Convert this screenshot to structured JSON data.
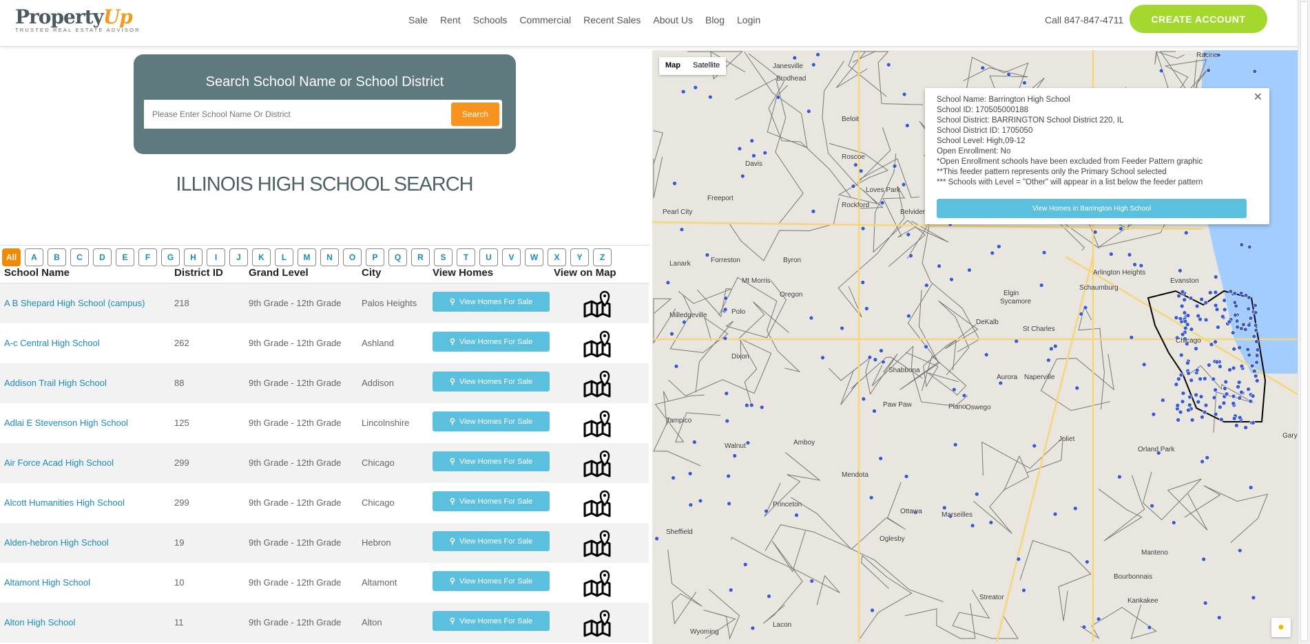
{
  "logo": {
    "text": "Property",
    "accent": "Up",
    "tagline": "TRUSTED REAL ESTATE ADVISOR"
  },
  "nav": [
    "Sale",
    "Rent",
    "Schools",
    "Commercial",
    "Recent Sales",
    "About Us",
    "Blog",
    "Login"
  ],
  "phone": "Call 847-847-4711",
  "cta": "CREATE ACCOUNT",
  "search": {
    "title": "Search School Name or School District",
    "placeholder": "Please Enter School Name Or District",
    "button": "Search"
  },
  "page_title": "ILLINOIS HIGH SCHOOL SEARCH",
  "letters": [
    "All",
    "A",
    "B",
    "C",
    "D",
    "E",
    "F",
    "G",
    "H",
    "I",
    "J",
    "K",
    "L",
    "M",
    "N",
    "O",
    "P",
    "Q",
    "R",
    "S",
    "T",
    "U",
    "V",
    "W",
    "X",
    "Y",
    "Z"
  ],
  "columns": [
    "School Name",
    "District ID",
    "Grand Level",
    "City",
    "View Homes",
    "View on Map"
  ],
  "view_button": "View Homes For Sale",
  "rows": [
    {
      "name": "A B Shepard High School (campus)",
      "district": "218",
      "level": "9th Grade - 12th Grade",
      "city": "Palos Heights"
    },
    {
      "name": "A-c Central High School",
      "district": "262",
      "level": "9th Grade - 12th Grade",
      "city": "Ashland"
    },
    {
      "name": "Addison Trail High School",
      "district": "88",
      "level": "9th Grade - 12th Grade",
      "city": "Addison"
    },
    {
      "name": "Adlai E Stevenson High School",
      "district": "125",
      "level": "9th Grade - 12th Grade",
      "city": "Lincolnshire"
    },
    {
      "name": "Air Force Acad High School",
      "district": "299",
      "level": "9th Grade - 12th Grade",
      "city": "Chicago"
    },
    {
      "name": "Alcott Humanities High School",
      "district": "299",
      "level": "9th Grade - 12th Grade",
      "city": "Chicago"
    },
    {
      "name": "Alden-hebron High School",
      "district": "19",
      "level": "9th Grade - 12th Grade",
      "city": "Hebron"
    },
    {
      "name": "Altamont High School",
      "district": "10",
      "level": "9th Grade - 12th Grade",
      "city": "Altamont"
    },
    {
      "name": "Alton High School",
      "district": "11",
      "level": "9th Grade - 12th Grade",
      "city": "Alton"
    }
  ],
  "map": {
    "types": [
      "Map",
      "Satellite"
    ],
    "popup": {
      "lines": [
        "School Name: Barrington High School",
        "School ID: 170505000188",
        "School District: BARRINGTON School District 220, IL",
        "School District ID: 1705050",
        "School Level: High,09-12",
        "Open Enrollment: No",
        "*Open Enrollment schools have been excluded from Feeder Pattern graphic",
        "**This feeder pattern represents only the Primary School selected",
        "*** Schools with Level = \"Other\" will appear in a list below the feeder pattern"
      ],
      "button": "View Homes in Barrington High School"
    },
    "labels": [
      "Janesville",
      "Racine",
      "Brodhead",
      "Beloit",
      "Roscoe",
      "Davis",
      "Freeport",
      "Rockford",
      "Loves Park",
      "Belvidere",
      "Pearl City",
      "Forreston",
      "Byron",
      "Lanark",
      "Mt Morris",
      "Oregon",
      "Sycamore",
      "DeKalb",
      "Elgin",
      "Schaumburg",
      "Arlington Heights",
      "Evanston",
      "Chicago",
      "St Charles",
      "Aurora",
      "Naperville",
      "Dixon",
      "Amboy",
      "Shabbona",
      "Paw Paw",
      "Plano",
      "Oswego",
      "Joliet",
      "Orland Park",
      "Gary",
      "Mendota",
      "Ottawa",
      "Marseilles",
      "Princeton",
      "Sheffield",
      "Oglesby",
      "Streator",
      "Kankakee",
      "Bourbonnais",
      "Manteno",
      "Tampico",
      "Walnut",
      "Wyoming",
      "Lacon",
      "Milledgeville",
      "Polo"
    ]
  }
}
